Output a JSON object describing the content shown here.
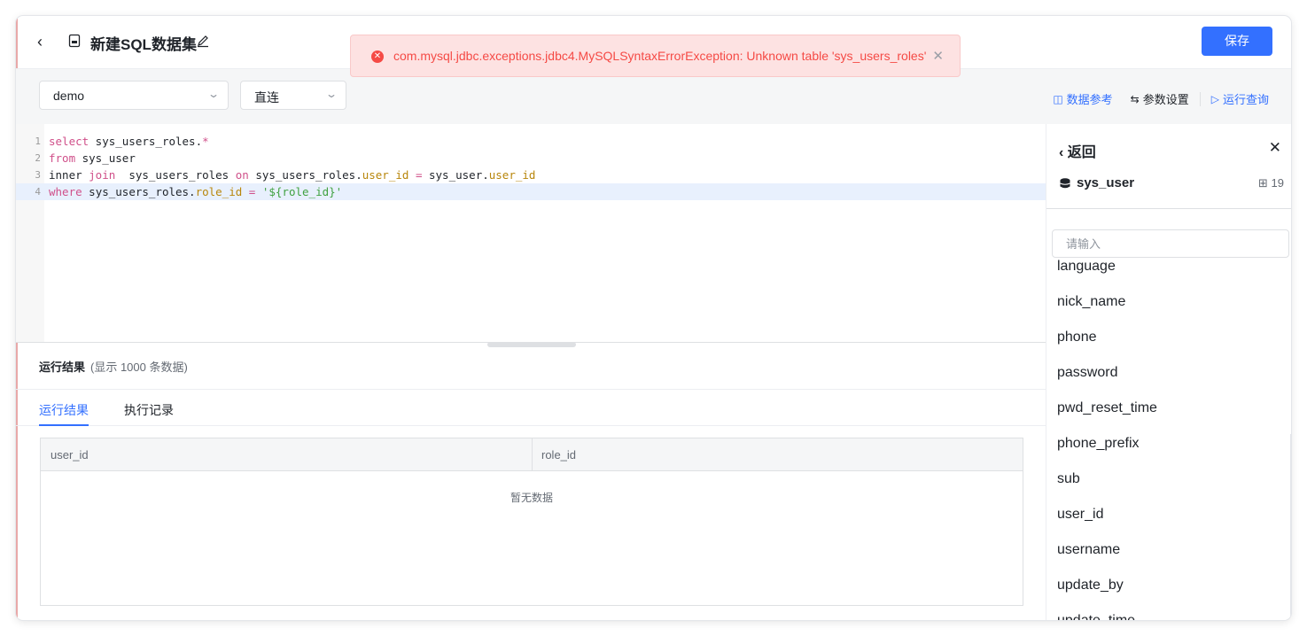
{
  "header": {
    "back_icon": "chevron-left-icon",
    "file_icon": "sql-file-icon",
    "title": "新建SQL数据集",
    "edit_icon": "pencil-icon",
    "save_label": "保存"
  },
  "toast": {
    "icon": "error-circle-icon",
    "message": "com.mysql.jdbc.exceptions.jdbc4.MySQLSyntaxErrorException: Unknown table 'sys_users_roles'",
    "close_icon": "close-icon"
  },
  "toolbar": {
    "datasource": "demo",
    "mode": "直连",
    "data_ref_label": "数据参考",
    "params_label": "参数设置",
    "run_label": "运行查询"
  },
  "editor": {
    "lines": [
      {
        "n": "1",
        "tokens": [
          [
            "k",
            "select"
          ],
          [
            "t",
            " sys_users_roles."
          ],
          [
            "k",
            "*"
          ]
        ]
      },
      {
        "n": "2",
        "tokens": [
          [
            "k",
            "from"
          ],
          [
            "t",
            " sys_user"
          ]
        ]
      },
      {
        "n": "3",
        "tokens": [
          [
            "t",
            "inner "
          ],
          [
            "k",
            "join"
          ],
          [
            "t",
            "  sys_users_roles "
          ],
          [
            "k",
            "on"
          ],
          [
            "t",
            " sys_users_roles."
          ],
          [
            "f",
            "user_id"
          ],
          [
            "t",
            " "
          ],
          [
            "k",
            "="
          ],
          [
            "t",
            " sys_user."
          ],
          [
            "f",
            "user_id"
          ]
        ]
      },
      {
        "n": "4",
        "tokens": [
          [
            "k",
            "where"
          ],
          [
            "t",
            " sys_users_roles."
          ],
          [
            "f",
            "role_id"
          ],
          [
            "t",
            " "
          ],
          [
            "k",
            "="
          ],
          [
            "t",
            " "
          ],
          [
            "s",
            "'${role_id}'"
          ]
        ]
      }
    ]
  },
  "results": {
    "title": "运行结果",
    "subtitle": "(显示 1000 条数据)",
    "tabs": [
      "运行结果",
      "执行记录"
    ],
    "columns": [
      "user_id",
      "role_id"
    ],
    "empty_text": "暂无数据"
  },
  "panel": {
    "back_label": "返回",
    "table_name": "sys_user",
    "field_count": "19",
    "search_placeholder": "请输入",
    "fields": [
      "language",
      "nick_name",
      "phone",
      "password",
      "pwd_reset_time",
      "phone_prefix",
      "sub",
      "user_id",
      "username",
      "update_by",
      "update_time"
    ]
  },
  "colors": {
    "primary": "#3370ff",
    "error": "#f54a45",
    "error_bg": "#fde2e2"
  }
}
